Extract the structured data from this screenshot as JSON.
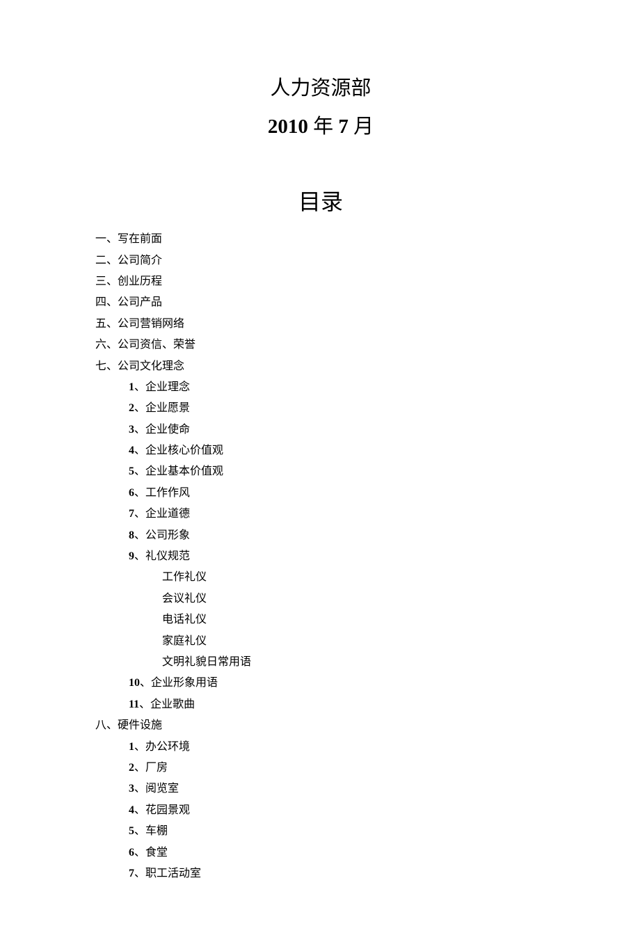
{
  "header": {
    "line1": "人力资源部",
    "line2_year": "2010",
    "line2_sep1": " 年 ",
    "line2_month": "7",
    "line2_sep2": " 月"
  },
  "toc": {
    "title": "目录",
    "items": [
      {
        "level": 1,
        "text": "一、写在前面"
      },
      {
        "level": 1,
        "text": "二、公司简介"
      },
      {
        "level": 1,
        "text": "三、创业历程"
      },
      {
        "level": 1,
        "text": "四、公司产品"
      },
      {
        "level": 1,
        "text": "五、公司营销网络"
      },
      {
        "level": 1,
        "text": "六、公司资信、荣誉"
      },
      {
        "level": 1,
        "text": "七、公司文化理念"
      },
      {
        "level": 2,
        "num": "1",
        "text": "、企业理念"
      },
      {
        "level": 2,
        "num": "2",
        "text": "、企业愿景"
      },
      {
        "level": 2,
        "num": "3",
        "text": "、企业使命"
      },
      {
        "level": 2,
        "num": "4",
        "text": "、企业核心价值观"
      },
      {
        "level": 2,
        "num": "5",
        "text": "、企业基本价值观"
      },
      {
        "level": 2,
        "num": "6",
        "text": "、工作作风"
      },
      {
        "level": 2,
        "num": "7",
        "text": "、企业道德"
      },
      {
        "level": 2,
        "num": "8",
        "text": "、公司形象"
      },
      {
        "level": 2,
        "num": "9",
        "text": "、礼仪规范"
      },
      {
        "level": 3,
        "text": "工作礼仪"
      },
      {
        "level": 3,
        "text": "会议礼仪"
      },
      {
        "level": 3,
        "text": "电话礼仪"
      },
      {
        "level": 3,
        "text": "家庭礼仪"
      },
      {
        "level": 3,
        "text": "文明礼貌日常用语"
      },
      {
        "level": 2,
        "num": "10",
        "text": "、企业形象用语"
      },
      {
        "level": 2,
        "num": "11",
        "text": "、企业歌曲"
      },
      {
        "level": 1,
        "text": "八、硬件设施"
      },
      {
        "level": 2,
        "num": "1",
        "text": "、办公环境"
      },
      {
        "level": 2,
        "num": "2",
        "text": "、厂房"
      },
      {
        "level": 2,
        "num": "3",
        "text": "、阅览室"
      },
      {
        "level": 2,
        "num": "4",
        "text": "、花园景观"
      },
      {
        "level": 2,
        "num": "5",
        "text": "、车棚"
      },
      {
        "level": 2,
        "num": "6",
        "text": "、食堂"
      },
      {
        "level": 2,
        "num": "7",
        "text": "、职工活动室"
      }
    ]
  }
}
